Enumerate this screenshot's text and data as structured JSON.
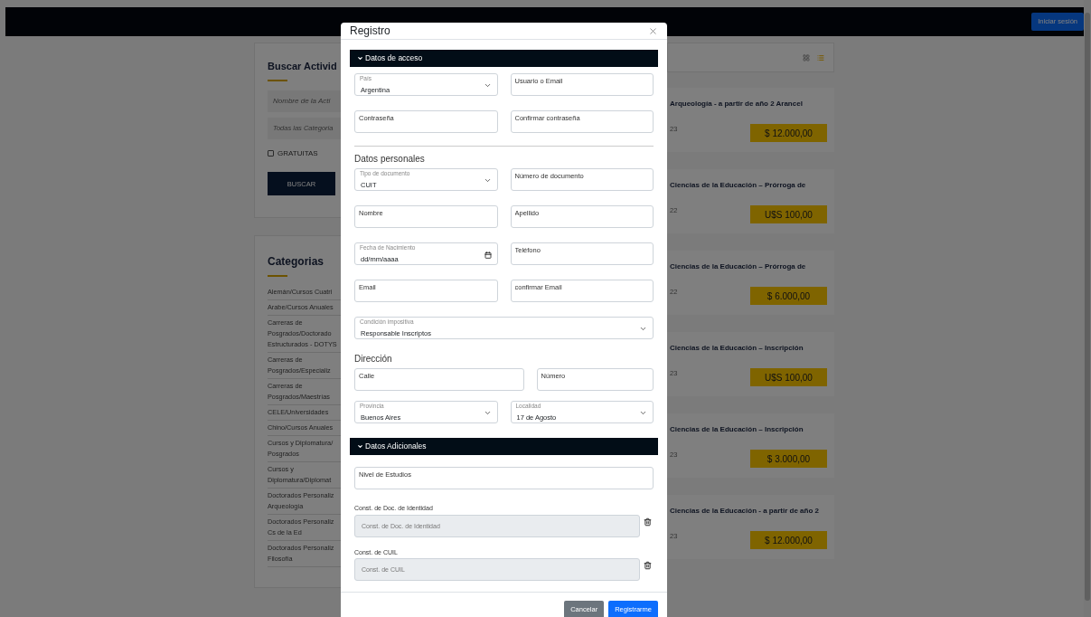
{
  "navbar": {
    "login_button": "Iniciar sesión"
  },
  "search_panel": {
    "title": "Buscar Activid",
    "name_placeholder": "Nombre de la Acti",
    "category_placeholder": "Todas las Categoria",
    "free_checkbox": {
      "label": "GRATUITAS",
      "checked": false
    },
    "search_button": "BUSCAR"
  },
  "categories": {
    "title": "Categorias",
    "items": [
      {
        "lines": [
          "Alemán/Cursos Cuatri"
        ]
      },
      {
        "lines": [
          "Arabe/Cursos Anuales"
        ]
      },
      {
        "lines": [
          "Carreras de",
          "Posgrados/Doctorado",
          "Estructurados - DOTYS"
        ]
      },
      {
        "lines": [
          "Carreras de",
          "Posgrados/Especializ"
        ]
      },
      {
        "lines": [
          "Carreras de",
          "Posgrados/Maestrías"
        ]
      },
      {
        "lines": [
          "CELE/Universidades"
        ]
      },
      {
        "lines": [
          "Chino/Cursos Anuales"
        ]
      },
      {
        "lines": [
          "Cursos y Diplomatura/",
          "Posgrados"
        ]
      },
      {
        "lines": [
          "Cursos y",
          "Diplomatura/Diplomat"
        ]
      },
      {
        "lines": [
          "Doctorados Personaliz",
          "Arqueología"
        ]
      },
      {
        "lines": [
          "Doctorados Personaliz",
          "Cs de la Ed"
        ]
      },
      {
        "lines": [
          "Doctorados Personaliz",
          "Filosofía"
        ]
      }
    ]
  },
  "view_toggle": [
    {
      "selected": false
    },
    {
      "selected": true
    }
  ],
  "activities": [
    {
      "title": "Arqueología - a partir de año 2 Arancel",
      "date": "23",
      "price": "$ 12.000,00"
    },
    {
      "title": "Ciencias de la Educación – Prórroga de",
      "date": "22",
      "price": "U$S 100,00"
    },
    {
      "title": "Ciencias de la Educación – Prórroga de",
      "date": "22",
      "price": "$ 6.000,00"
    },
    {
      "title": "Ciencias de la Educación – Inscripción",
      "date": "23",
      "price": "U$S 100,00"
    },
    {
      "title": "Ciencias de la Educación – Inscripción",
      "date": "23",
      "price": "$ 3.000,00"
    },
    {
      "title": "Ciencias de la Educación - a partir de año 2",
      "date": "23",
      "price": "$ 12.000,00"
    }
  ],
  "modal": {
    "title": "Registro",
    "sections": [
      {
        "title": "Datos de acceso",
        "expanded": true,
        "rows": [
          {
            "kind": "pair",
            "fields": [
              {
                "kind": "select",
                "label": "País",
                "value": "Argentina"
              },
              {
                "kind": "input",
                "placeholder": "Usuario o Email"
              }
            ]
          },
          {
            "kind": "pair",
            "fields": [
              {
                "kind": "input",
                "placeholder": "Contraseña"
              },
              {
                "kind": "input",
                "placeholder": "Confirmar contraseña"
              }
            ]
          },
          {
            "kind": "divider"
          },
          {
            "kind": "heading",
            "text": "Datos personales"
          },
          {
            "kind": "pair",
            "fields": [
              {
                "kind": "select",
                "label": "Tipo de documento",
                "value": "CUIT"
              },
              {
                "kind": "input",
                "placeholder": "Número de documento"
              }
            ]
          },
          {
            "kind": "pair",
            "fields": [
              {
                "kind": "input",
                "placeholder": "Nombre"
              },
              {
                "kind": "input",
                "placeholder": "Apellido"
              }
            ]
          },
          {
            "kind": "pair",
            "fields": [
              {
                "kind": "date",
                "label": "Fecha de Nacimiento",
                "value": "dd/mm/aaaa"
              },
              {
                "kind": "input",
                "placeholder": "Teléfono"
              }
            ]
          },
          {
            "kind": "pair",
            "fields": [
              {
                "kind": "input",
                "placeholder": "Email"
              },
              {
                "kind": "input",
                "placeholder": "confirmar Email"
              }
            ]
          },
          {
            "kind": "single",
            "fields": [
              {
                "kind": "select",
                "label": "Condición impositiva",
                "value": "Responsable Inscriptos"
              }
            ]
          },
          {
            "kind": "heading",
            "text": "Dirección"
          },
          {
            "kind": "split",
            "fields": [
              {
                "kind": "input",
                "placeholder": "Calle"
              },
              {
                "kind": "input",
                "placeholder": "Número"
              }
            ]
          },
          {
            "kind": "pair",
            "fields": [
              {
                "kind": "select",
                "label": "Provincia",
                "value": "Buenos Aires"
              },
              {
                "kind": "select",
                "label": "Localidad",
                "value": "17 de Agosto"
              }
            ]
          }
        ]
      },
      {
        "title": "Datos Adicionales",
        "expanded": true,
        "rows": [
          {
            "kind": "single",
            "fields": [
              {
                "kind": "input",
                "placeholder": "Nivel de Estudios"
              }
            ]
          },
          {
            "kind": "file",
            "label": "Const. de Doc. de Identidad",
            "placeholder": "Const. de Doc. de Identidad"
          },
          {
            "kind": "file",
            "label": "Const. de CUIL",
            "placeholder": "Const. de CUIL"
          }
        ]
      }
    ],
    "buttons": [
      {
        "label": "Cancelar",
        "kind": "secondary"
      },
      {
        "label": "Registrarme",
        "kind": "primary"
      }
    ]
  }
}
